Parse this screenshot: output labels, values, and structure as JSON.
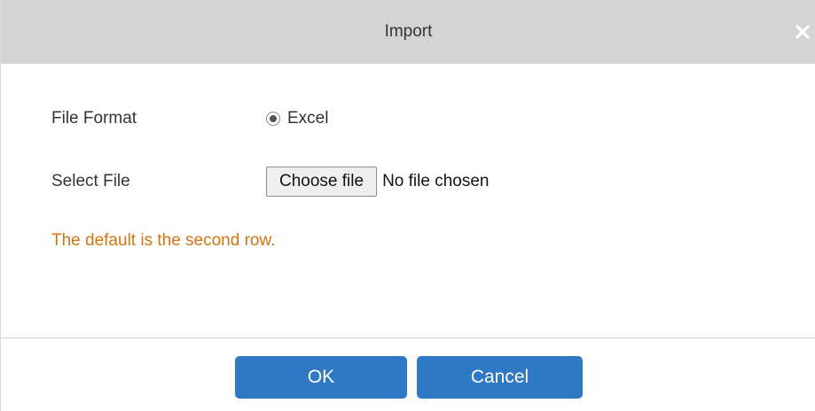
{
  "dialog": {
    "title": "Import",
    "close_icon": "close-icon"
  },
  "form": {
    "file_format": {
      "label": "File Format",
      "options": [
        {
          "label": "Excel",
          "selected": true
        }
      ]
    },
    "select_file": {
      "label": "Select File",
      "button_label": "Choose file",
      "status": "No file chosen"
    },
    "hint": "The default is the second row."
  },
  "footer": {
    "ok_label": "OK",
    "cancel_label": "Cancel"
  },
  "colors": {
    "titlebar": "#d4d4d4",
    "hint": "#d4730f",
    "primary_button": "#2f78c4"
  }
}
